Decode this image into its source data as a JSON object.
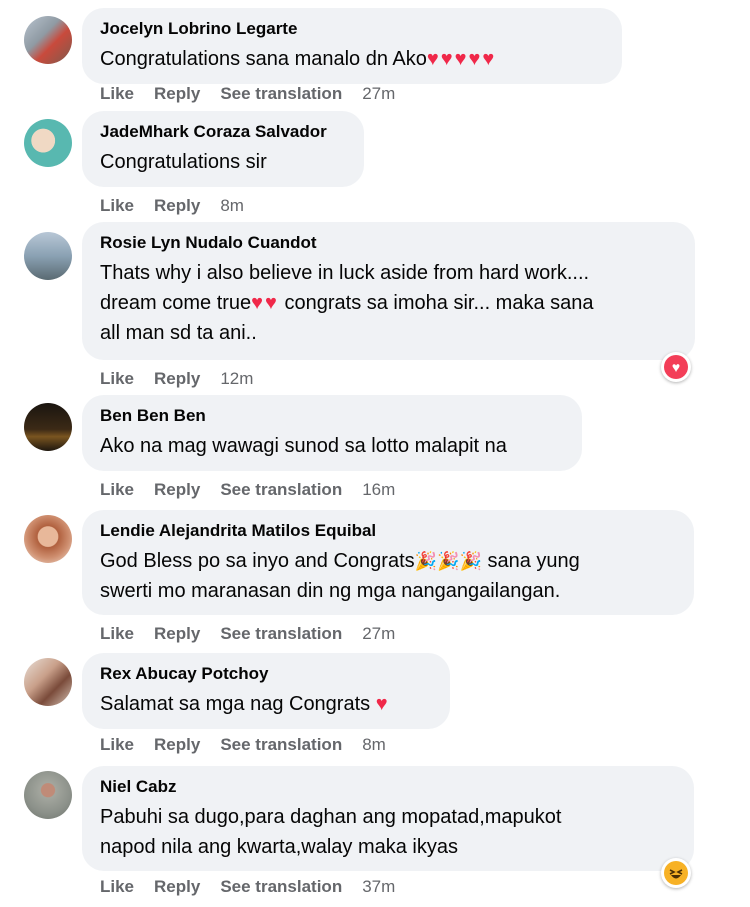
{
  "actions": {
    "like": "Like",
    "reply": "Reply",
    "see_translation": "See translation"
  },
  "comments": [
    {
      "author": "Jocelyn Lobrino Legarte",
      "text": "Congratulations sana manalo dn Ako",
      "text_emoji": "♥♥♥♥♥",
      "time": "27m"
    },
    {
      "author": "JadeMhark Coraza Salvador",
      "text": "Congratulations sir",
      "time": "8m"
    },
    {
      "author": "Rosie Lyn Nudalo Cuandot",
      "text_line1": "Thats why i also believe in luck aside from hard work....",
      "text_line2_a": "dream come true",
      "text_line2_emoji": "♥♥",
      "text_line2_b": " congrats sa imoha sir... maka sana",
      "text_line3": "all man sd ta ani..",
      "time": "12m",
      "reaction": "love"
    },
    {
      "author": "Ben Ben Ben",
      "text": "Ako na mag wawagi sunod sa lotto malapit na",
      "time": "16m"
    },
    {
      "author": "Lendie Alejandrita Matilos Equibal",
      "text_line1_a": "God Bless po sa inyo and Congrats",
      "text_line1_emoji": "🎉🎉🎉",
      "text_line1_b": " sana yung",
      "text_line2": "swerti mo maranasan din ng mga nangangailangan.",
      "time": "27m"
    },
    {
      "author": "Rex Abucay Potchoy",
      "text": "Salamat sa mga nag Congrats",
      "text_emoji": "♥",
      "time": "8m"
    },
    {
      "author": "Niel Cabz",
      "text_line1": "Pabuhi sa dugo,para daghan ang mopatad,mapukot",
      "text_line2": "napod nila ang kwarta,walay maka ikyas",
      "time": "37m",
      "reaction": "haha"
    }
  ],
  "colors": {
    "bubble": "#f0f2f5",
    "meta": "#65676b",
    "heart": "#f02849",
    "love_reaction": "#f33e58",
    "haha_reaction": "#f7b125"
  }
}
